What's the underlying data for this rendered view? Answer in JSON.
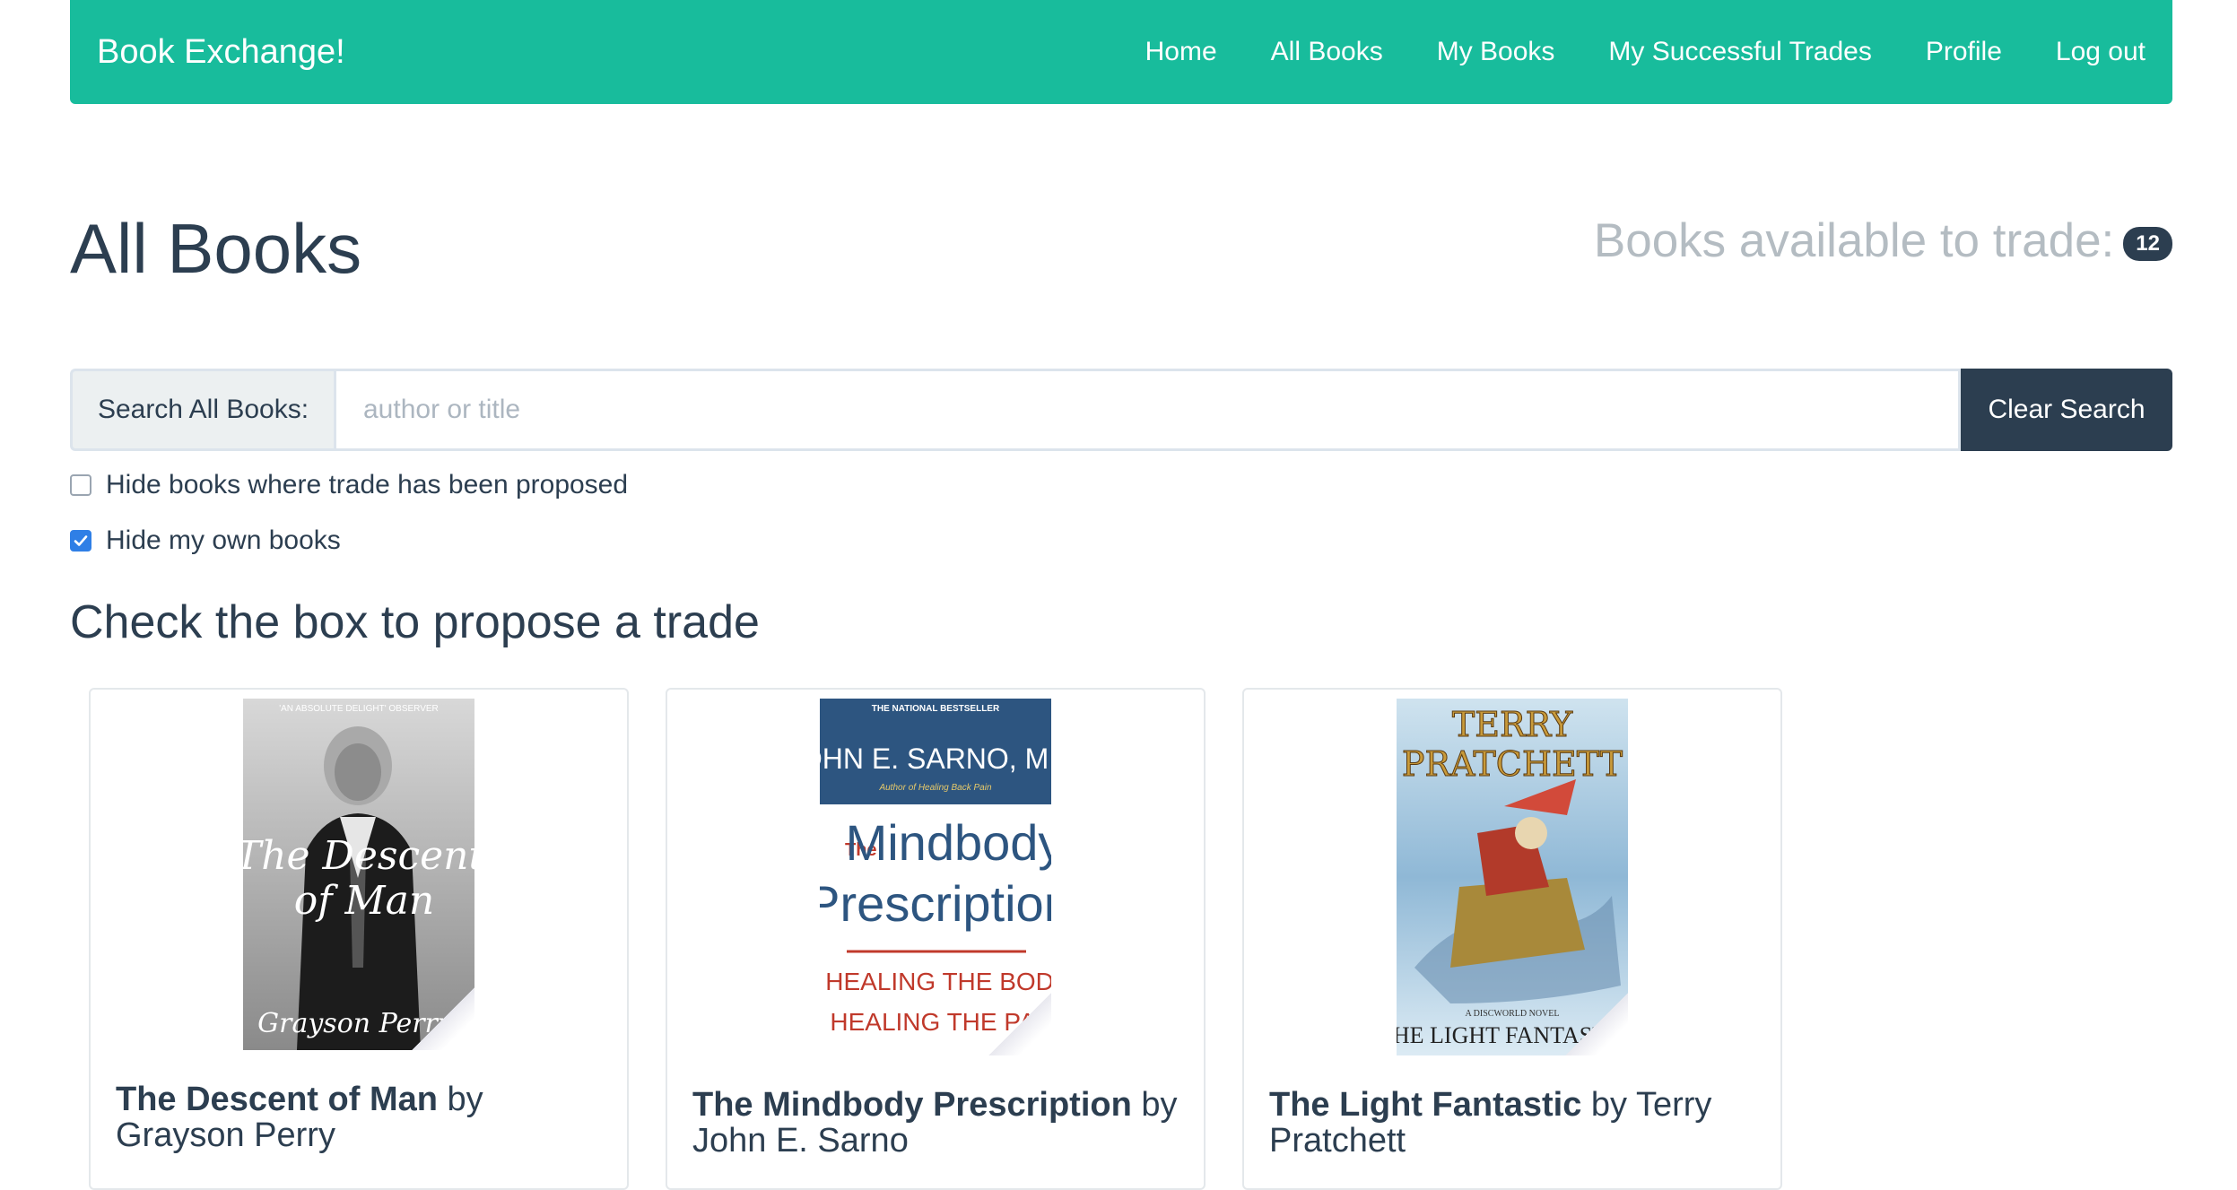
{
  "navbar": {
    "brand": "Book Exchange!",
    "links": [
      "Home",
      "All Books",
      "My Books",
      "My Successful Trades",
      "Profile",
      "Log out"
    ]
  },
  "page": {
    "title": "All Books",
    "available_label": "Books available to trade:",
    "available_count": "12"
  },
  "search": {
    "label": "Search All Books:",
    "placeholder": "author or title",
    "value": "",
    "clear_label": "Clear Search"
  },
  "filters": [
    {
      "label": "Hide books where trade has been proposed",
      "checked": false
    },
    {
      "label": "Hide my own books",
      "checked": true
    }
  ],
  "subheading": "Check the box to propose a trade",
  "books": [
    {
      "title": "The Descent of Man",
      "by": "by",
      "author": "Grayson Perry",
      "cover": {
        "top_text": "'AN ABSOLUTE DELIGHT' OBSERVER",
        "main_text": "The Descent of Man",
        "author_text": "Grayson Perry"
      }
    },
    {
      "title": "The Mindbody Prescription",
      "by": "by",
      "author": "John E. Sarno",
      "cover": {
        "top_text": "THE NATIONAL BESTSELLER",
        "author_text": "JOHN E. SARNO, M.D.",
        "sub_text": "Author of Healing Back Pain",
        "the_text": "The",
        "main_text_1": "Mindbody",
        "main_text_2": "Prescription",
        "tagline_1": "HEALING THE BODY,",
        "tagline_2": "HEALING THE PAIN"
      }
    },
    {
      "title": "The Light Fantastic",
      "by": "by",
      "author": "Terry Pratchett",
      "cover": {
        "author_text_1": "TERRY",
        "author_text_2": "PRATCHETT",
        "series_text": "A DISCWORLD NOVEL",
        "main_text": "THE LIGHT FANTASTIC"
      }
    }
  ],
  "colors": {
    "navbar": "#18bc9c",
    "primary_text": "#2c3e50",
    "muted": "#b4bcc2",
    "checkbox_checked": "#2f7fe6"
  }
}
